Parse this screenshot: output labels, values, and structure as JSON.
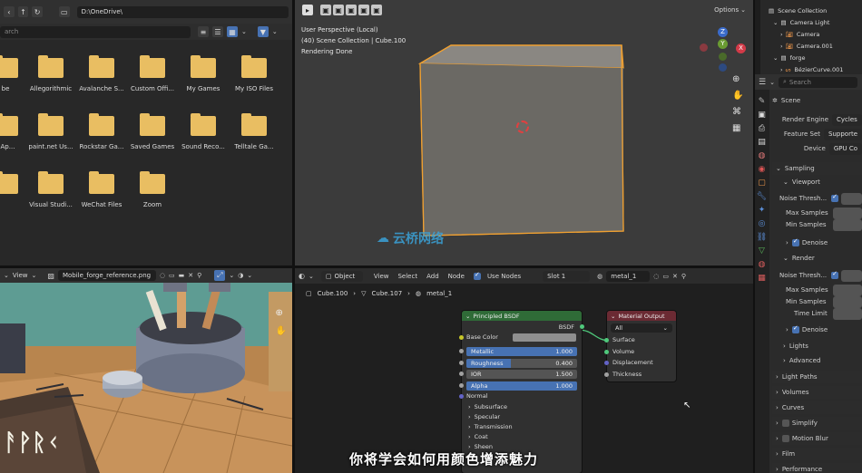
{
  "file_browser": {
    "path": "D:\\OneDrive\\",
    "search_placeholder": "arch",
    "folders_row1": [
      "be",
      "Allegorithmic",
      "Avalanche S...",
      "Custom Offi...",
      "My Games",
      "My ISO Files"
    ],
    "folders_row2": [
      "t Ap...",
      "paint.net Us...",
      "Rockstar Ga...",
      "Saved Games",
      "Sound Reco...",
      "Telltale Ga..."
    ],
    "folders_row3": [
      "",
      "Visual Studi...",
      "WeChat Files",
      "Zoom"
    ]
  },
  "viewport": {
    "options_label": "Options",
    "overlay_line1": "User Perspective (Local)",
    "overlay_line2": "(40) Scene Collection | Cube.100",
    "overlay_line3": "Rendering Done",
    "gizmo": {
      "z": "Z",
      "y": "Y",
      "x": "X"
    }
  },
  "image_editor": {
    "view_label": "View",
    "image_name": "Mobile_forge_reference.png"
  },
  "node_editor": {
    "object_label": "Object",
    "menu": [
      "View",
      "Select",
      "Add",
      "Node"
    ],
    "use_nodes_label": "Use Nodes",
    "slot_label": "Slot 1",
    "material_name": "metal_1",
    "breadcrumb": [
      "Cube.100",
      "Cube.107",
      "metal_1"
    ],
    "bsdf_node": {
      "title": "Principled BSDF",
      "output": "BSDF",
      "base_color_label": "Base Color",
      "fields": [
        {
          "label": "Metallic",
          "value": "1.000",
          "fill": 1.0
        },
        {
          "label": "Roughness",
          "value": "0.400",
          "fill": 0.4
        },
        {
          "label": "IOR",
          "value": "1.500",
          "fill": 0.0
        },
        {
          "label": "Alpha",
          "value": "1.000",
          "fill": 1.0
        }
      ],
      "normal_label": "Normal",
      "subpanels": [
        "Subsurface",
        "Specular",
        "Transmission",
        "Coat",
        "Sheen"
      ]
    },
    "output_node": {
      "title": "Material Output",
      "target": "All",
      "inputs": [
        "Surface",
        "Volume",
        "Displacement",
        "Thickness"
      ]
    }
  },
  "outliner": {
    "items": [
      {
        "label": "Scene Collection"
      },
      {
        "label": "Camera Light"
      },
      {
        "label": "Camera"
      },
      {
        "label": "Camera.001"
      },
      {
        "label": "forge"
      },
      {
        "label": "BézierCurve.001"
      }
    ]
  },
  "properties": {
    "search_placeholder": "Search",
    "scene_label": "Scene",
    "render_engine_label": "Render Engine",
    "render_engine_value": "Cycles",
    "feature_set_label": "Feature Set",
    "feature_set_value": "Supporte",
    "device_label": "Device",
    "device_value": "GPU Co",
    "sampling": "Sampling",
    "viewport": "Viewport",
    "noise_threshold": "Noise Thresh...",
    "max_samples": "Max Samples",
    "min_samples": "Min Samples",
    "denoise": "Denoise",
    "render": "Render",
    "time_limit": "Time Limit",
    "lights": "Lights",
    "advanced": "Advanced",
    "light_paths": "Light Paths",
    "volumes": "Volumes",
    "curves": "Curves",
    "simplify": "Simplify",
    "motion_blur": "Motion Blur",
    "film": "Film",
    "performance": "Performance"
  },
  "subtitle": "你将学会如何用颜色增添魅力",
  "watermark": "云桥网络",
  "colors": {
    "bsdf_header": "#2f6b37",
    "output_header": "#6b2a33",
    "accent_blue": "#4772b3",
    "cube_outline": "#f0a030",
    "folder": "#e9be62"
  }
}
